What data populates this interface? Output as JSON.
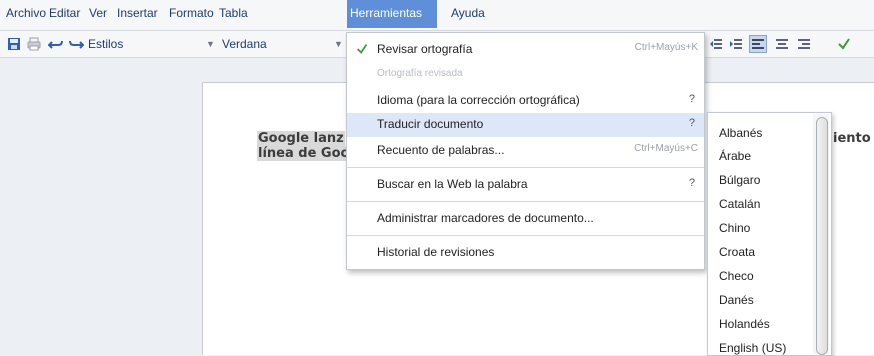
{
  "menubar": {
    "items": [
      "Archivo",
      "Editar",
      "Ver",
      "Insertar",
      "Formato",
      "Tabla",
      "Herramientas",
      "Ayuda"
    ],
    "active": "Herramientas"
  },
  "toolbar": {
    "style_select": "Estilos",
    "font_select": "Verdana"
  },
  "document": {
    "line1": "Google lanz",
    "line2": "línea de Goo",
    "right_fragment": "iento"
  },
  "tools_menu": {
    "spell_check": {
      "label": "Revisar ortografía",
      "shortcut": "Ctrl+Mayús+K"
    },
    "spelling_reviewed": {
      "label": "Ortografía revisada"
    },
    "language": {
      "label": "Idioma (para la corrección ortográfica)",
      "hint": "?"
    },
    "translate": {
      "label": "Traducir documento",
      "hint": "?"
    },
    "word_count": {
      "label": "Recuento de palabras...",
      "shortcut": "Ctrl+Mayús+C"
    },
    "web_search": {
      "label": "Buscar en la Web la palabra",
      "hint": "?"
    },
    "bookmarks": {
      "label": "Administrar marcadores de documento..."
    },
    "revisions": {
      "label": "Historial de revisiones"
    }
  },
  "languages": [
    "Albanés",
    "Árabe",
    "Búlgaro",
    "Catalán",
    "Chino",
    "Croata",
    "Checo",
    "Danés",
    "Holandés",
    "English (US)"
  ],
  "colors": {
    "menu_active": "#5e8fd8",
    "menu_text": "#1f3b73",
    "highlight": "#dde7f7",
    "selection": "#d9d9d9"
  }
}
